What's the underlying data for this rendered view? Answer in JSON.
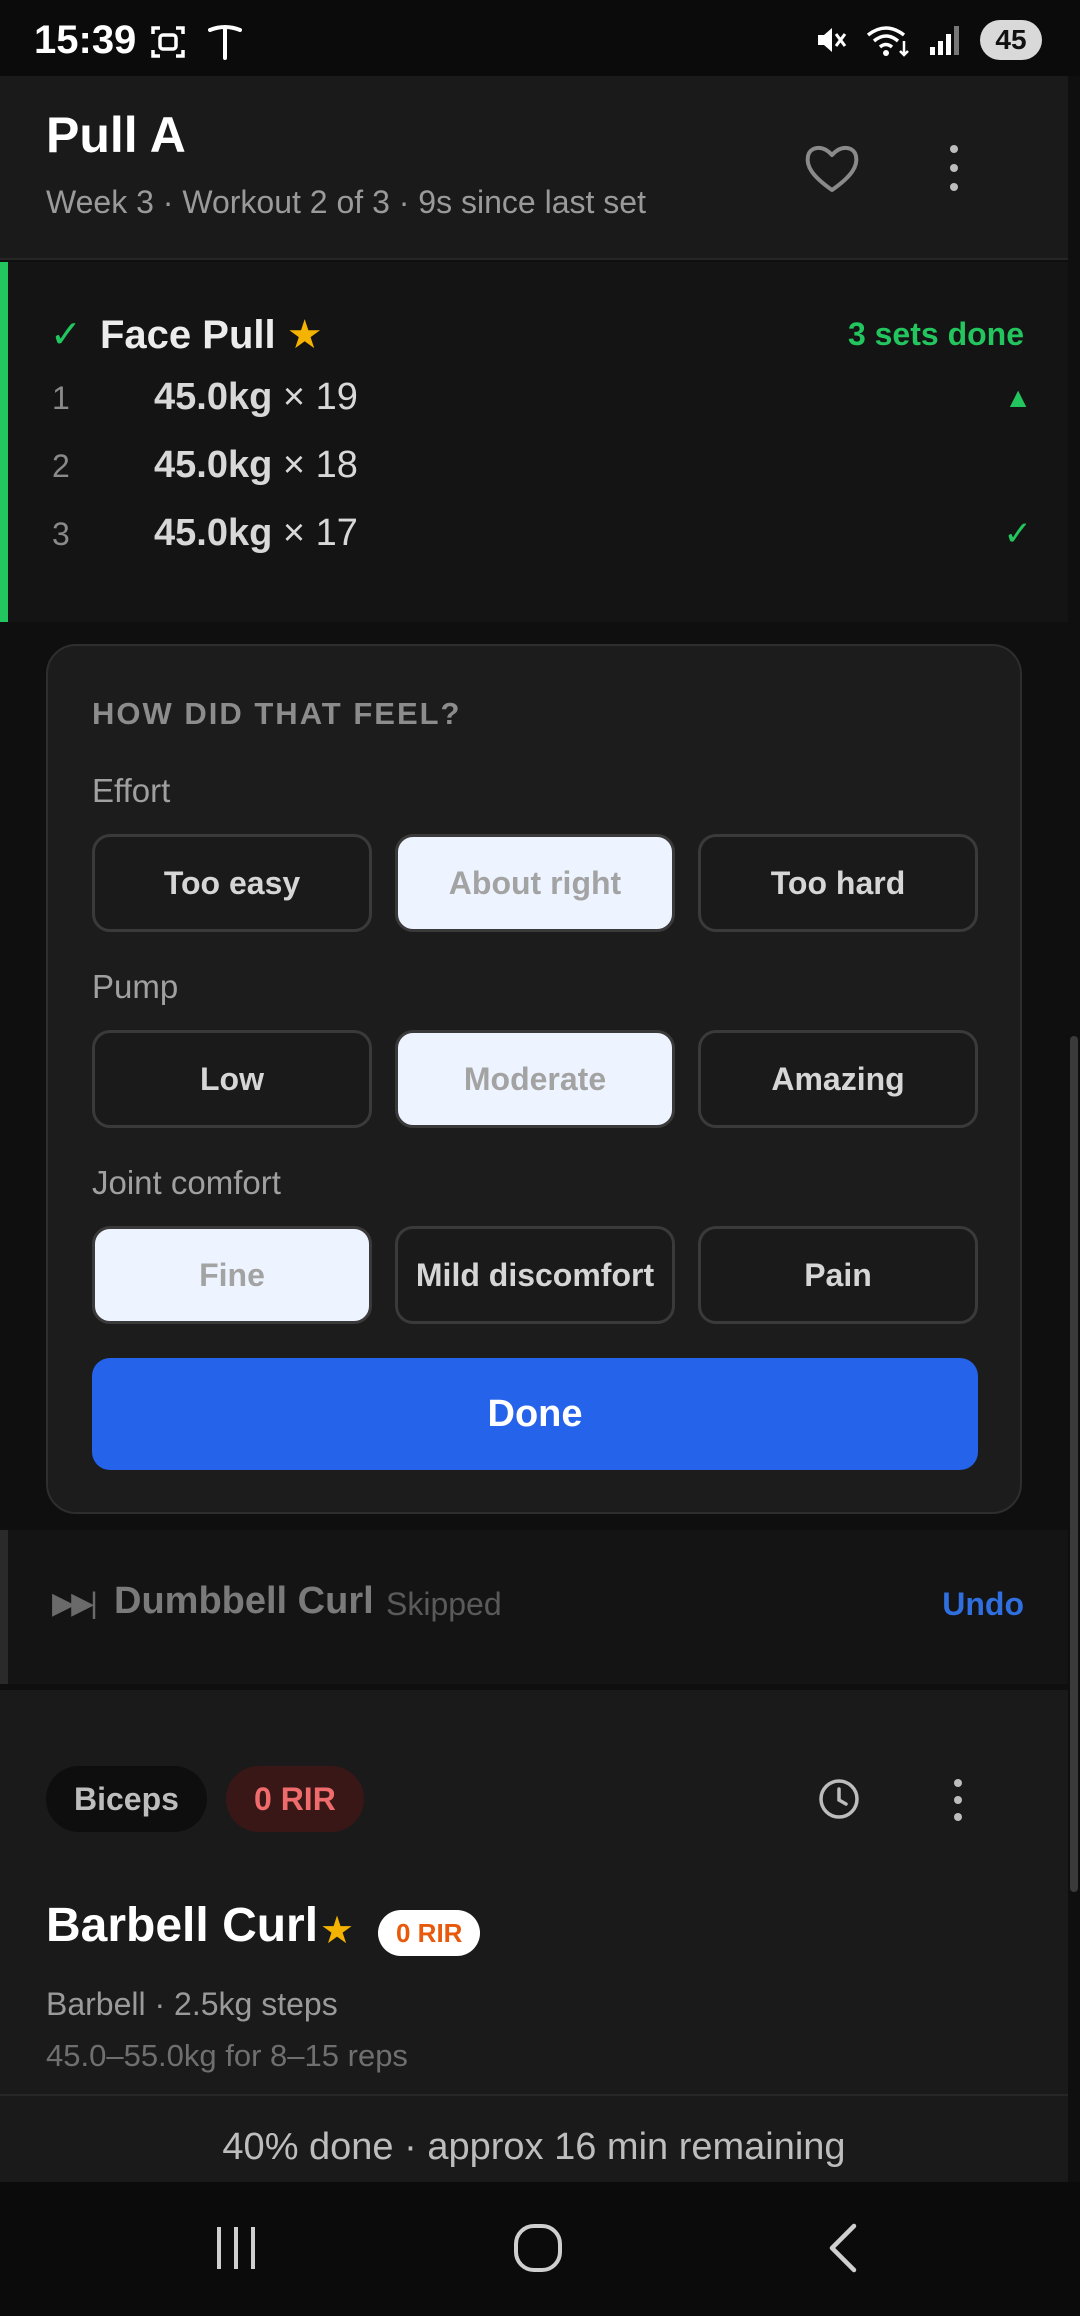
{
  "status_bar": {
    "time": "15:39",
    "left_icons": [
      "screenshot-icon",
      "tesla-icon"
    ],
    "right_icons": [
      "mute-icon",
      "wifi-icon",
      "signal-icon"
    ],
    "battery": "45"
  },
  "header": {
    "title": "Pull A",
    "subtitle": "Week 3 · Workout 2 of 3 · 9s since last set"
  },
  "completed_exercise": {
    "name": "Face Pull",
    "star": "★",
    "status": "3 sets done",
    "sets": [
      {
        "num": "1",
        "weight": "45.0kg",
        "reps": " × 19",
        "mark": "▲"
      },
      {
        "num": "2",
        "weight": "45.0kg",
        "reps": " × 18",
        "mark": ""
      },
      {
        "num": "3",
        "weight": "45.0kg",
        "reps": " × 17",
        "mark": "✓"
      }
    ]
  },
  "feedback": {
    "heading": "HOW DID THAT FEEL?",
    "groups": [
      {
        "label": "Effort",
        "options": [
          "Too easy",
          "About right",
          "Too hard"
        ],
        "selected": 1
      },
      {
        "label": "Pump",
        "options": [
          "Low",
          "Moderate",
          "Amazing"
        ],
        "selected": 1
      },
      {
        "label": "Joint comfort",
        "options": [
          "Fine",
          "Mild discomfort",
          "Pain"
        ],
        "selected": 0
      }
    ],
    "done_label": "Done"
  },
  "skipped_exercise": {
    "name": "Dumbbell Curl",
    "tag": "Skipped",
    "undo_label": "Undo"
  },
  "next_exercise": {
    "muscle": "Biceps",
    "rir_chip": "0 RIR",
    "name": "Barbell Curl",
    "star": "★",
    "rir_pill": "0 RIR",
    "meta": "Barbell · 2.5kg steps",
    "range": "45.0–55.0kg for 8–15 reps"
  },
  "progress": {
    "text": "40% done · approx 16 min remaining"
  },
  "colors": {
    "accent_green": "#22c55e",
    "primary_blue": "#2563eb",
    "star_yellow": "#f5b301",
    "rir_red": "#f06b6b"
  }
}
